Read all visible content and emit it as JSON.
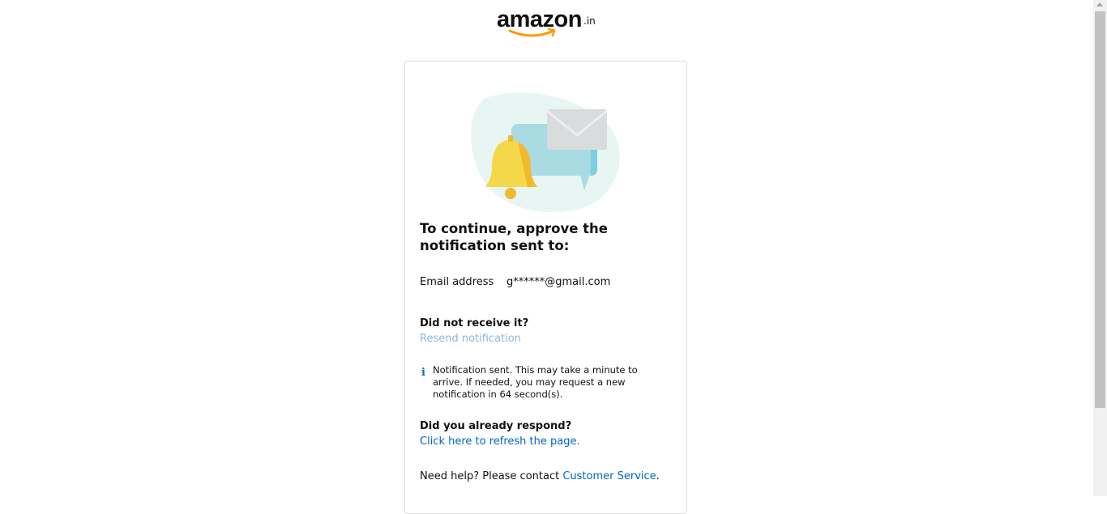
{
  "header": {
    "logo_word": "amazon",
    "logo_tld": ".in"
  },
  "card": {
    "title": "To continue, approve the notification sent to:",
    "email_label": "Email address",
    "email_value": "g******@gmail.com",
    "not_received_heading": "Did not receive it?",
    "resend_link": "Resend notification",
    "info_icon": "i",
    "info_text": "Notification sent. This may take a minute to arrive. If needed, you may request a new notification in 64 second(s).",
    "already_responded_heading": "Did you already respond?",
    "refresh_link": "Click here to refresh the page.",
    "help_text": "Need help? Please contact ",
    "help_link": "Customer Service",
    "help_end": "."
  },
  "colors": {
    "link": "#0066c0",
    "link_disabled": "#8fb6d9",
    "brand_orange": "#ff9900"
  },
  "icons": [
    "amazon-smile-logo",
    "notification-illustration",
    "info-icon"
  ]
}
